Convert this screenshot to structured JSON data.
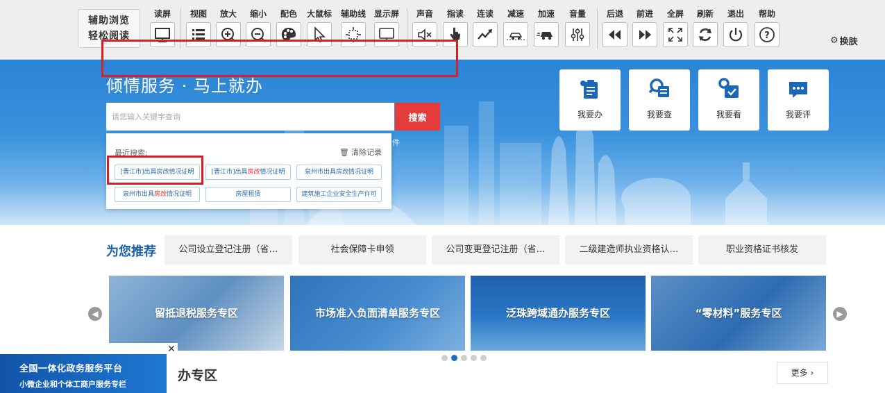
{
  "toolbar": {
    "brand_line1": "辅助浏览",
    "brand_line2": "轻松阅读",
    "tools": [
      {
        "label": "读屏",
        "icon": "monitor-icon"
      },
      {
        "label": "视图",
        "icon": "list-view-icon"
      },
      {
        "label": "放大",
        "icon": "zoom-in-icon"
      },
      {
        "label": "缩小",
        "icon": "zoom-out-icon"
      },
      {
        "label": "配色",
        "icon": "palette-icon"
      },
      {
        "label": "大鼠标",
        "icon": "cursor-icon"
      },
      {
        "label": "辅助线",
        "icon": "crosshair-icon"
      },
      {
        "label": "显示屏",
        "icon": "display-icon"
      },
      {
        "label": "声音",
        "icon": "mute-icon"
      },
      {
        "label": "指读",
        "icon": "finger-icon"
      },
      {
        "label": "连读",
        "icon": "trend-icon"
      },
      {
        "label": "减速",
        "icon": "slow-icon"
      },
      {
        "label": "加速",
        "icon": "fast-icon"
      },
      {
        "label": "音量",
        "icon": "volume-slider-icon"
      },
      {
        "label": "后退",
        "icon": "rewind-icon"
      },
      {
        "label": "前进",
        "icon": "forward-icon"
      },
      {
        "label": "全屏",
        "icon": "fullscreen-icon"
      },
      {
        "label": "刷新",
        "icon": "refresh-icon"
      },
      {
        "label": "退出",
        "icon": "power-icon"
      },
      {
        "label": "帮助",
        "icon": "help-icon"
      }
    ],
    "skin_label": "换肤"
  },
  "hero": {
    "title": "倾情服务 · 马上就办",
    "search_placeholder": "请您输入关键字查询",
    "search_button": "搜索",
    "partial_text": "件",
    "quick_links": [
      {
        "label": "我要办",
        "icon": "clipboard-icon"
      },
      {
        "label": "我要查",
        "icon": "search-doc-icon"
      },
      {
        "label": "我要看",
        "icon": "view-check-icon"
      },
      {
        "label": "我要评",
        "icon": "comment-icon"
      }
    ]
  },
  "recent_search": {
    "header": "最近搜索:",
    "clear_label": "清除记录",
    "chips": [
      {
        "pre": "[晋江市]出具房改情况证明",
        "hot": "",
        "post": ""
      },
      {
        "pre": "[晋江市]出具",
        "hot": "房改",
        "post": "情况证明"
      },
      {
        "pre": "泉州市出具房改情况证明",
        "hot": "",
        "post": ""
      },
      {
        "pre": "泉州市出具",
        "hot": "房改",
        "post": "情况证明"
      },
      {
        "pre": "房屋租赁",
        "hot": "",
        "post": ""
      },
      {
        "pre": "建筑施工企业安全生产许可",
        "hot": "",
        "post": ""
      }
    ]
  },
  "recommend": {
    "title": "为您推荐",
    "items": [
      "公司设立登记注册（省…",
      "社会保障卡申领",
      "公司变更登记注册（省…",
      "二级建造师执业资格认…",
      "职业资格证书核发"
    ]
  },
  "banners": [
    "留抵退税服务专区",
    "市场准入负面清单服务专区",
    "泛珠跨域通办服务专区",
    "“零材料”服务专区"
  ],
  "carousel": {
    "pages": 5,
    "active_index": 1
  },
  "special": {
    "title_partial": "办专区",
    "more_label": "更多"
  },
  "float_ad": {
    "line1": "全国一体化政务服务平台",
    "line2": "小微企业和个体工商户服务专栏",
    "close_symbol": "✕"
  },
  "colors": {
    "primary": "#2a83d4",
    "accent_red": "#e43b3b",
    "highlight_box": "#d61f26"
  }
}
